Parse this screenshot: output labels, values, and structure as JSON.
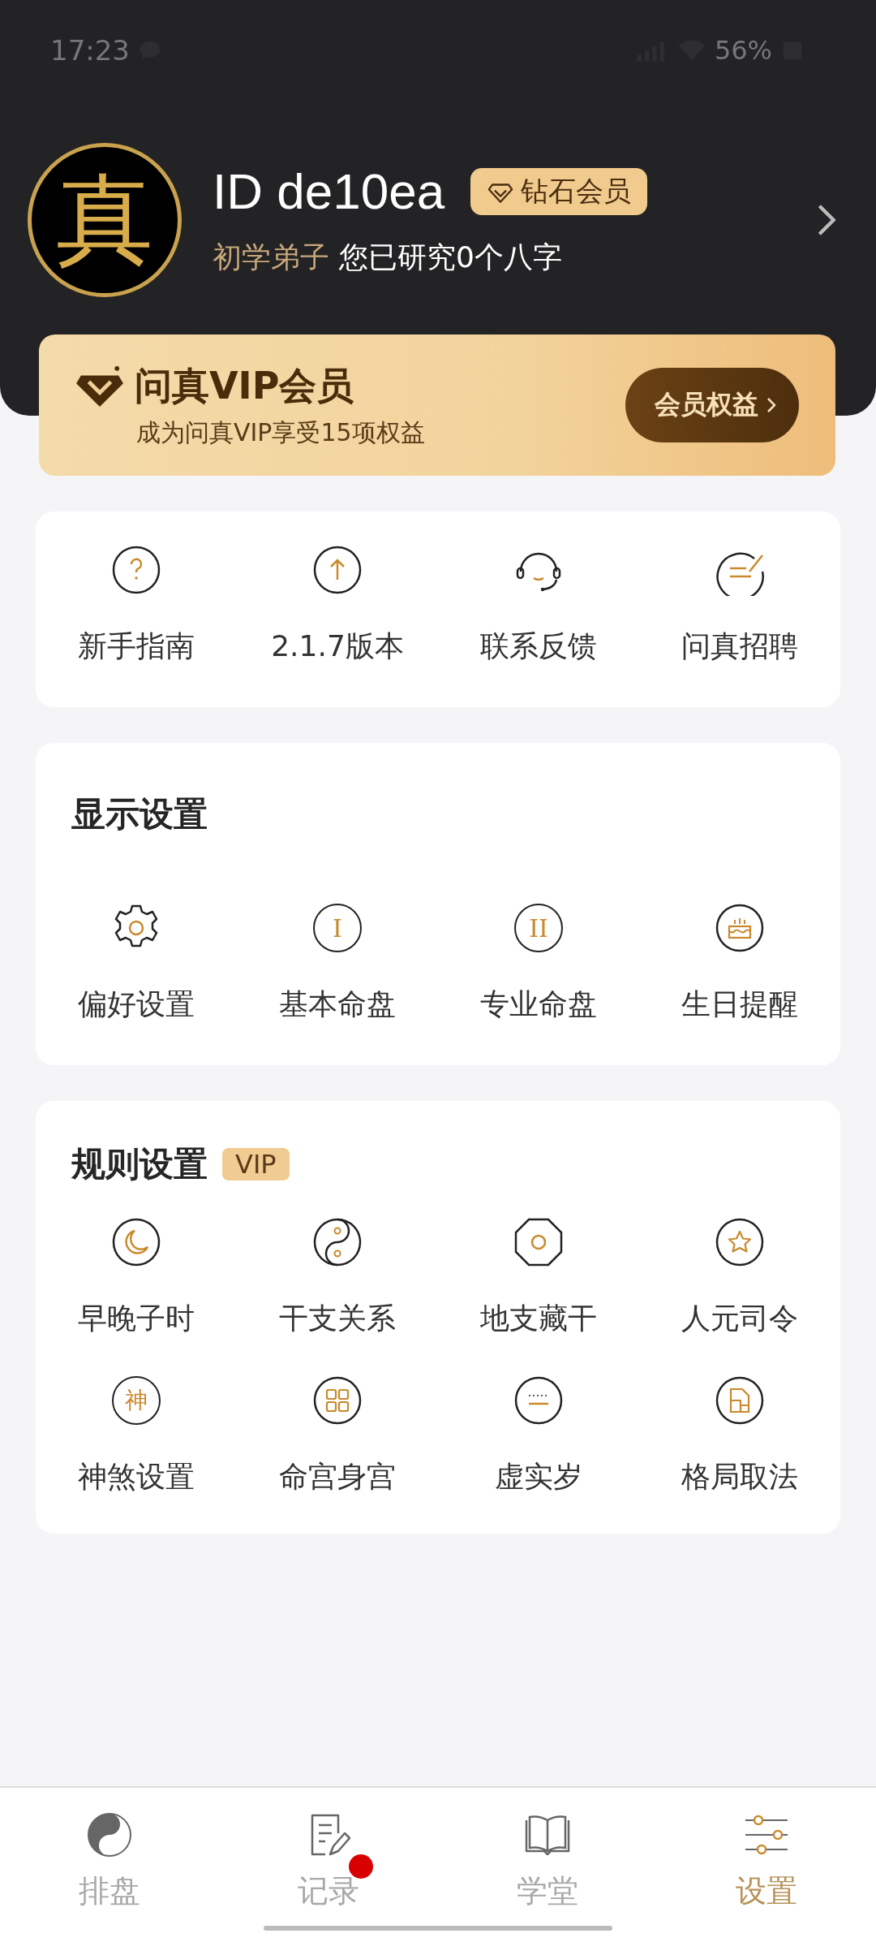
{
  "status_bar": {
    "time": "17:23",
    "battery": "56%"
  },
  "profile": {
    "avatar_glyph": "真",
    "id": "ID de10ea",
    "badge": "钻石会员",
    "rank": "初学弟子",
    "summary": "您已研究0个八字"
  },
  "vip_banner": {
    "title": "问真VIP会员",
    "subtitle": "成为问真VIP享受15项权益",
    "button": "会员权益"
  },
  "quick_links": [
    {
      "label": "新手指南"
    },
    {
      "label": "2.1.7版本"
    },
    {
      "label": "联系反馈"
    },
    {
      "label": "问真招聘"
    }
  ],
  "sections": [
    {
      "title": "显示设置",
      "items": [
        {
          "label": "偏好设置"
        },
        {
          "label": "基本命盘",
          "glyph": "I"
        },
        {
          "label": "专业命盘",
          "glyph": "II"
        },
        {
          "label": "生日提醒"
        }
      ]
    },
    {
      "title": "规则设置",
      "tag": "VIP",
      "items": [
        {
          "label": "早晚子时"
        },
        {
          "label": "干支关系"
        },
        {
          "label": "地支藏干"
        },
        {
          "label": "人元司令"
        },
        {
          "label": "神煞设置",
          "glyph": "神"
        },
        {
          "label": "命宫身宫"
        },
        {
          "label": "虚实岁"
        },
        {
          "label": "格局取法"
        }
      ]
    }
  ],
  "bottom_nav": [
    {
      "label": "排盘",
      "selected": false,
      "dot": false
    },
    {
      "label": "记录",
      "selected": false,
      "dot": true
    },
    {
      "label": "学堂",
      "selected": false,
      "dot": false
    },
    {
      "label": "设置",
      "selected": true,
      "dot": false
    }
  ]
}
